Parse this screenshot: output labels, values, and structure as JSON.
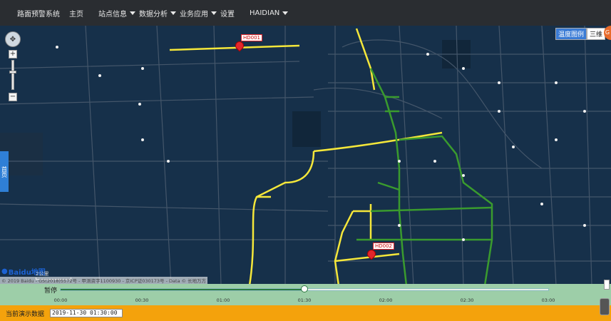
{
  "nav": {
    "brand": "路面预警系统",
    "items": [
      {
        "label": "主页",
        "dropdown": false
      },
      {
        "label": "站点信息",
        "dropdown": true
      },
      {
        "label": "数据分析",
        "dropdown": true
      },
      {
        "label": "业务应用",
        "dropdown": true
      },
      {
        "label": "设置",
        "dropdown": false
      },
      {
        "label": "HAIDIAN",
        "dropdown": true
      }
    ]
  },
  "map": {
    "layer_buttons": [
      "温度图例",
      "三维"
    ],
    "markers": [
      {
        "id": "HD001"
      },
      {
        "id": "HD002"
      }
    ],
    "left_tab": "首页",
    "logo_text": "Baidu地图",
    "scale_label": "2公里",
    "copyright": "© 2019 Baidu - GS(2018)5572号 - 甲测资字1100930 - 京ICP证030173号 - Data © 长地万方",
    "colors": {
      "background": "#16304a",
      "road_yellow": "#f5e73a",
      "road_green": "#3a9b2e",
      "marker": "#e2262b"
    }
  },
  "timeline": {
    "pause_label": "暂停",
    "ticks": [
      "00:00",
      "00:30",
      "01:00",
      "01:30",
      "02:00",
      "02:30",
      "03:00"
    ],
    "progress": 0.5
  },
  "status": {
    "label": "当前演示数据",
    "value": "2019-11-30 01:30:00"
  }
}
